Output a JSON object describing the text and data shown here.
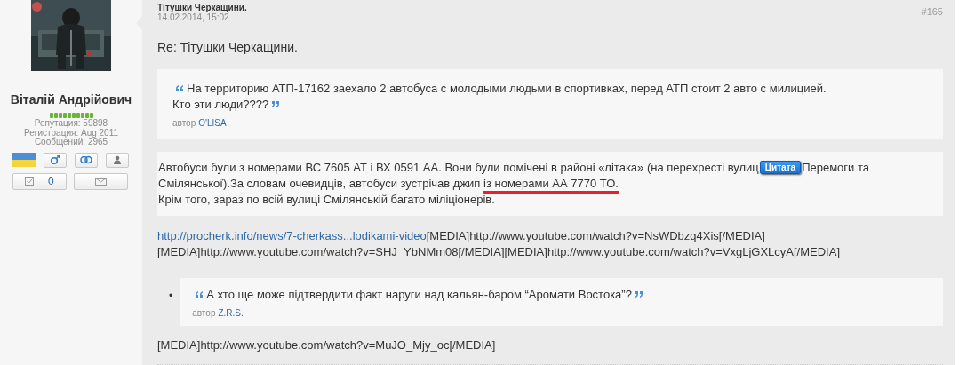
{
  "author": {
    "name": "Віталій Андрійович",
    "online": false,
    "reputation": {
      "stars": 10
    },
    "stats": [
      "Репутация: 59898",
      "Регистрация: Aug 2011",
      "Сообщений: 2965"
    ],
    "likes_count": "0"
  },
  "post": {
    "title": "Тітушки Черкащини.",
    "date": "14.02.2014, 15:02",
    "number": "#165",
    "subject": "Re: Тітушки Черкащини.",
    "quote": {
      "lines": [
        "На территорию АТП-17162 заехало 2 автобуса с молодыми людьми в спортивках, перед АТП стоит 2 авто с милицией.",
        "Кто эти люди????"
      ],
      "author_label": "автор",
      "author": "O'LISA"
    },
    "body": [
      [
        {
          "kind": "text",
          "text": "Автобуси були з номерами ВС 7605 АТ і ВХ 0591 АА. Вони були помічені в районі «літака» (на перехресті вулиц"
        },
        {
          "kind": "button",
          "text": "Цитата"
        },
        {
          "kind": "text",
          "text": "Перемоги та"
        }
      ],
      [
        {
          "kind": "text",
          "text": "Смілянської).За словам очевидців, автобуси зустрічав джип"
        },
        {
          "kind": "underlined",
          "text": "із номерами АА 7770 ТО."
        }
      ],
      [
        {
          "kind": "text",
          "text": "Крім того, зараз по всій вулиці Смілянській багато міліціонерів."
        }
      ]
    ],
    "links": [
      [
        {
          "kind": "link",
          "text": "http://procherk.info/news/7-cherkass...lodikami-video"
        },
        {
          "kind": "text",
          "text": "[MEDIA]http://www.youtube.com/watch?v=NsWDbzq4Xis[/MEDIA]"
        }
      ],
      [
        {
          "kind": "text",
          "text": "[MEDIA]http://www.youtube.com/watch?v=SHJ_YbNMm08[/MEDIA][MEDIA]http://www.youtube.com/watch?v=VxgLjGXLcyA[/MEDIA]"
        }
      ]
    ],
    "list_quote": {
      "bullet": "•",
      "lines": [
        "А хто ще може підтвердити факт наруги над кальян-баром “Аромати Востока”?"
      ],
      "author_label": "автор",
      "author": "Z.R.S."
    },
    "footer_text": "[MEDIA]http://www.youtube.com/watch?v=MuJO_Mjy_oc[/MEDIA]"
  }
}
